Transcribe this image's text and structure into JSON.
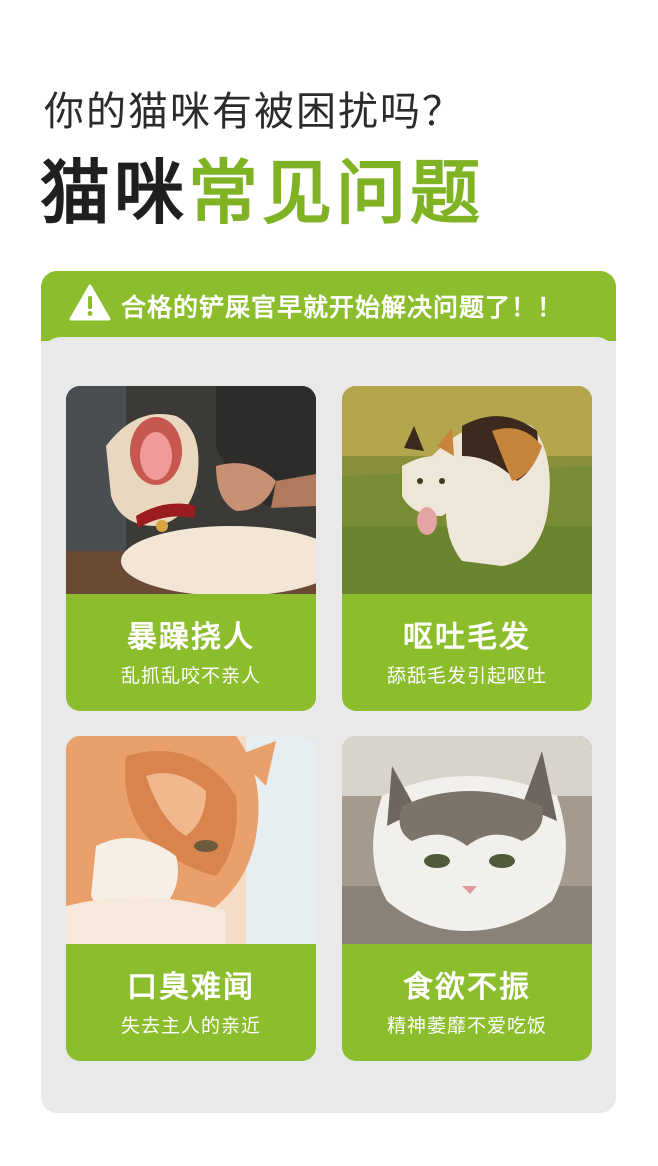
{
  "header": {
    "subtitle": "你的猫咪有被困扰吗？",
    "title_dark": "猫咪",
    "title_green": "常见问题"
  },
  "banner": {
    "text": "合格的铲屎官早就开始解决问题了！！",
    "icon": "warning-icon"
  },
  "colors": {
    "accent_green": "#8bbd2c",
    "title_green": "#7fb324",
    "panel_bg": "#e9e9e9"
  },
  "cards": [
    {
      "title": "暴躁挠人",
      "desc": "乱抓乱咬不亲人",
      "photo": "yawning-cat-photo"
    },
    {
      "title": "呕吐毛发",
      "desc": "舔舐毛发引起呕吐",
      "photo": "vomiting-calico-cat-photo"
    },
    {
      "title": "口臭难闻",
      "desc": "失去主人的亲近",
      "photo": "sleeping-orange-cat-photo"
    },
    {
      "title": "食欲不振",
      "desc": "精神萎靡不爱吃饭",
      "photo": "lying-tabby-cat-photo"
    }
  ]
}
